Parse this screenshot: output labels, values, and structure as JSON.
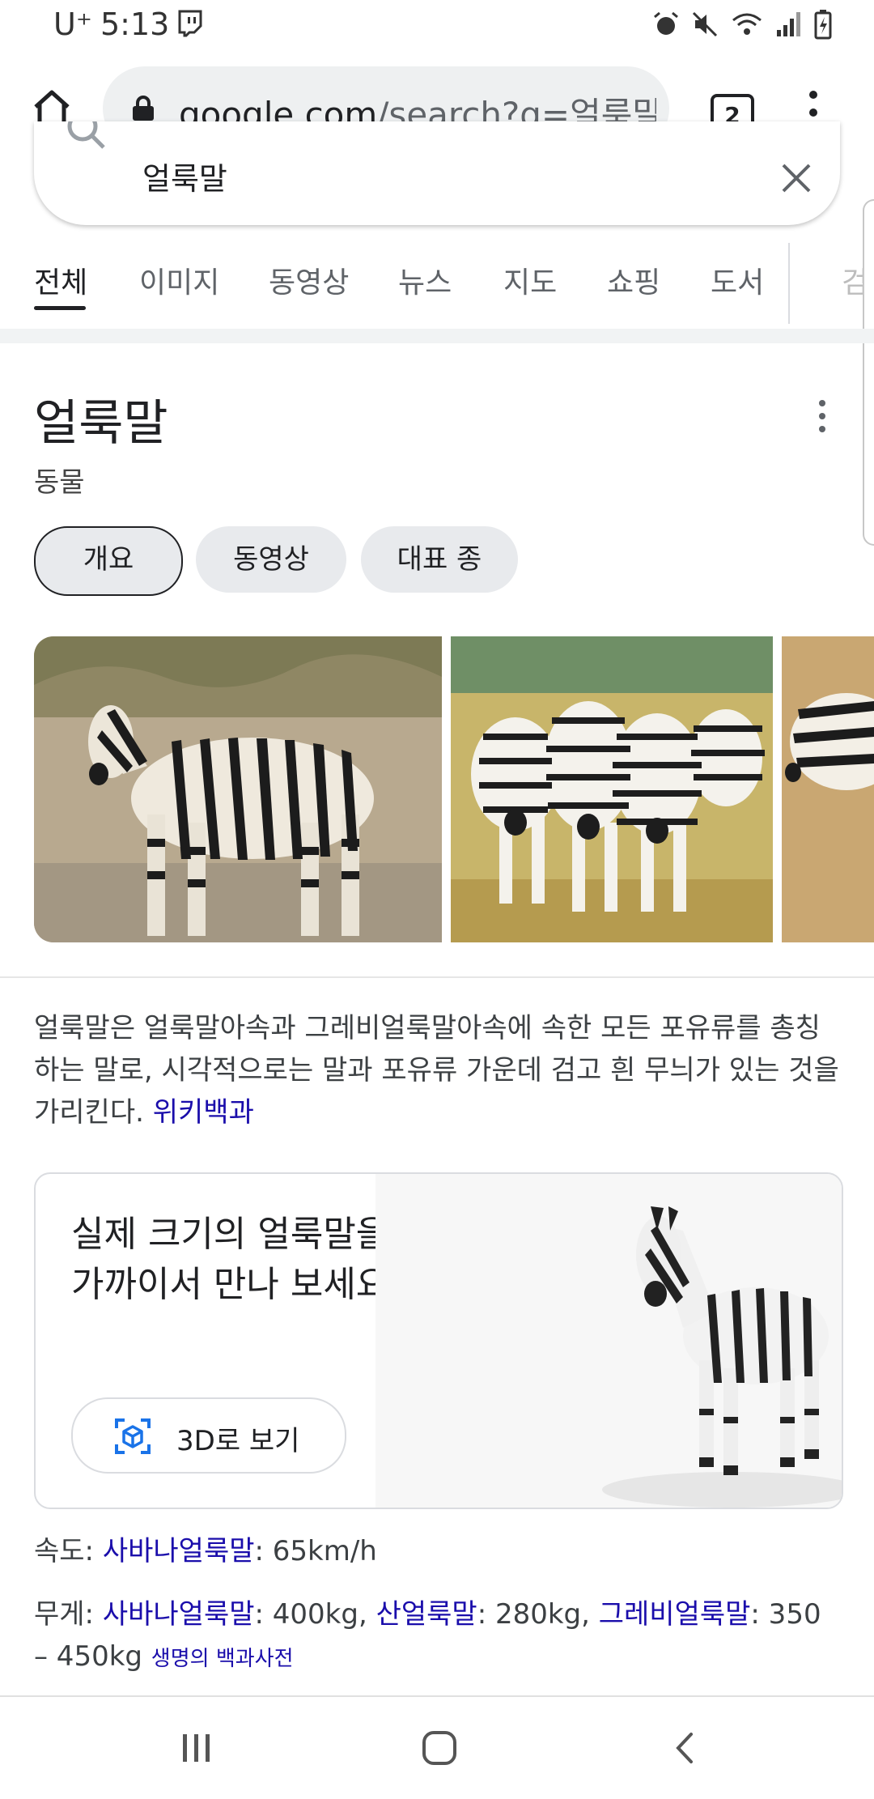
{
  "status_bar": {
    "carrier": "U⁺",
    "time": "5:13"
  },
  "browser": {
    "url_host": "google.com",
    "url_path": "/search?q=얼룩말",
    "tab_count": "2"
  },
  "search": {
    "query": "얼룩말"
  },
  "tabs": [
    {
      "label": "전체",
      "active": true
    },
    {
      "label": "이미지"
    },
    {
      "label": "동영상"
    },
    {
      "label": "뉴스"
    },
    {
      "label": "지도"
    },
    {
      "label": "쇼핑"
    },
    {
      "label": "도서"
    },
    {
      "label": "검"
    }
  ],
  "knowledge_panel": {
    "title": "얼룩말",
    "subtitle": "동물",
    "chips": [
      "개요",
      "동영상",
      "대표 종"
    ],
    "description": "얼룩말은 얼룩말아속과 그레비얼룩말아속에 속한 모든 포유류를 총칭하는 말로, 시각적으로는 말과 포유류 가운데 검고 흰 무늬가 있는 것을 가리킨다.",
    "description_source": "위키백과",
    "card_3d": {
      "text": "실제 크기의 얼룩말을 가까이서 만나 보세요",
      "button": "3D로 보기"
    },
    "facts": {
      "speed_label": "속도: ",
      "speed_link": "사바나얼룩말",
      "speed_value": ": 65km/h",
      "weight_label": "무게: ",
      "weight_link1": "사바나얼룩말",
      "weight_value1": ": 400kg, ",
      "weight_link2": "산얼룩말",
      "weight_value2": ": 280kg, ",
      "weight_link3": "그레비얼룩말",
      "weight_value3": ": 350 – 450kg ",
      "weight_source": "생명의 백과사전"
    }
  },
  "colors": {
    "link": "#1a0dab",
    "chip_bg": "#e8eaed",
    "omnibox_bg": "#eef0f1"
  }
}
